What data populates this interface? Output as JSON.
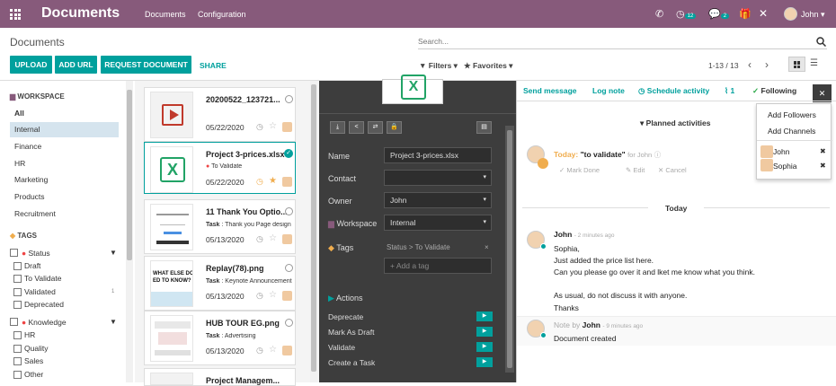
{
  "nav": {
    "brand": "Documents",
    "menu": [
      "Documents",
      "Configuration"
    ],
    "activity_count": "12",
    "message_count": "2",
    "user": "John"
  },
  "control": {
    "title": "Documents",
    "search_placeholder": "Search...",
    "buttons": [
      "UPLOAD",
      "ADD URL",
      "REQUEST DOCUMENT"
    ],
    "share": "SHARE",
    "filters": "Filters",
    "favorites": "Favorites",
    "pager": "1-13 / 13"
  },
  "workspace": {
    "header": "WORKSPACE",
    "items": [
      "All",
      "Internal",
      "Finance",
      "HR",
      "Marketing",
      "Products",
      "Recruitment"
    ]
  },
  "tags": {
    "header": "TAGS",
    "status_label": "Status",
    "status_items": [
      "Draft",
      "To Validate",
      "Validated",
      "Deprecated"
    ],
    "validated_count": "1",
    "knowledge_label": "Knowledge",
    "knowledge_items": [
      "HR",
      "Quality",
      "Sales",
      "Other"
    ]
  },
  "cards": [
    {
      "title": "20200522_123721...",
      "sub": "",
      "date": "05/22/2020"
    },
    {
      "title": "Project 3-prices.xlsx",
      "sub": "To Validate",
      "date": "05/22/2020"
    },
    {
      "title": "11 Thank You Optio...",
      "sub_bold": "Task",
      "sub": "Thank you Page design",
      "date": "05/13/2020"
    },
    {
      "title": "Replay(78).png",
      "sub_bold": "Task",
      "sub": "Keynote Announcement",
      "date": "05/13/2020"
    },
    {
      "title": "HUB TOUR EG.png",
      "sub_bold": "Task",
      "sub": "Advertising",
      "date": "05/13/2020"
    },
    {
      "title": "Project Managem..."
    }
  ],
  "thumb_text": "WHAT ELSE DO ED TO KNOW?",
  "inspector": {
    "name_label": "Name",
    "name_value": "Project 3-prices.xlsx",
    "contact_label": "Contact",
    "owner_label": "Owner",
    "owner_value": "John",
    "workspace_label": "Workspace",
    "workspace_value": "Internal",
    "tags_label": "Tags",
    "tag_value": "Status > To Validate",
    "tag_remove": "×",
    "add_tag_placeholder": "Add a tag",
    "actions_label": "Actions",
    "actions": [
      "Deprecate",
      "Mark As Draft",
      "Validate",
      "Create a Task"
    ]
  },
  "chatter": {
    "send_message": "Send message",
    "log_note": "Log note",
    "schedule": "Schedule activity",
    "attachments": "1",
    "following": "Following",
    "planned": "Planned activities",
    "activity_today": "Today:",
    "activity_name": "\"to validate\"",
    "activity_for": "for John",
    "mark_done": "Mark Done",
    "edit": "Edit",
    "cancel": "Cancel",
    "separator": "Today",
    "msg1_author": "John",
    "msg1_time": "- 2 minutes ago",
    "msg1_lines": [
      "Sophia,",
      "Just added the price list here.",
      "Can you please go over it and lket me know what you think.",
      "",
      "As usual, do not discuss it with anyone.",
      "Thanks"
    ],
    "note_prefix": "Note by",
    "note_author": "John",
    "note_time": "- 9 minutes ago",
    "note_body": "Document created"
  },
  "followers_dropdown": {
    "items": [
      "Add Followers",
      "Add Channels"
    ],
    "followers": [
      "John",
      "Sophia"
    ]
  },
  "colors": {
    "brand": "#875a7b",
    "accent": "#00a09d",
    "inspector_bg": "#3d3d3d"
  }
}
